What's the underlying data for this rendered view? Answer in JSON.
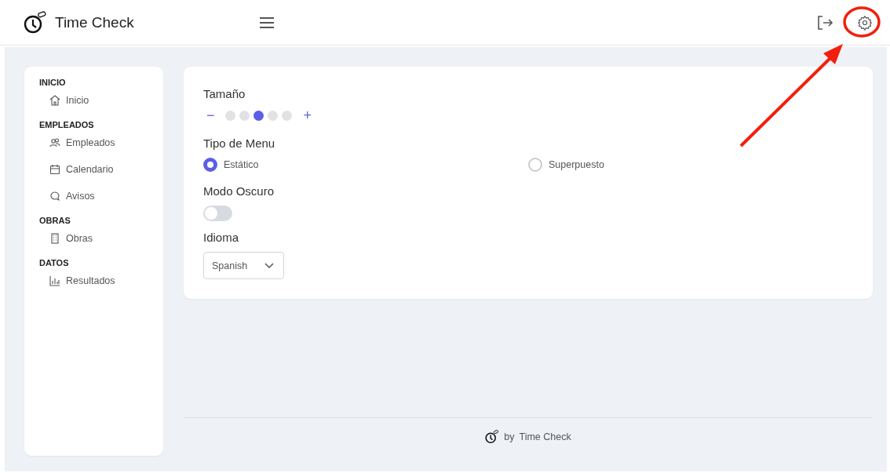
{
  "header": {
    "title": "Time Check"
  },
  "sidebar": {
    "sections": [
      {
        "heading": "INICIO",
        "items": [
          {
            "label": "Inicio",
            "kind": "home"
          }
        ]
      },
      {
        "heading": "EMPLEADOS",
        "items": [
          {
            "label": "Empleados",
            "kind": "people"
          },
          {
            "label": "Calendario",
            "kind": "calendar"
          },
          {
            "label": "Avisos",
            "kind": "chat"
          }
        ]
      },
      {
        "heading": "OBRAS",
        "items": [
          {
            "label": "Obras",
            "kind": "building"
          }
        ]
      },
      {
        "heading": "DATOS",
        "items": [
          {
            "label": "Resultados",
            "kind": "chart"
          }
        ]
      }
    ]
  },
  "settings": {
    "size": {
      "label": "Tamaño",
      "minus": "−",
      "plus": "+",
      "steps": [
        {
          "selected": false
        },
        {
          "selected": false
        },
        {
          "selected": true
        },
        {
          "selected": false
        },
        {
          "selected": false
        }
      ]
    },
    "menu_type": {
      "label": "Tipo de Menu",
      "options": [
        {
          "label": "Estático",
          "selected": true
        },
        {
          "label": "Superpuesto",
          "selected": false
        }
      ]
    },
    "dark_mode": {
      "label": "Modo Oscuro",
      "on": false
    },
    "language": {
      "label": "Idioma",
      "value": "Spanish"
    }
  },
  "footer": {
    "text": "by",
    "brand": "Time Check"
  }
}
